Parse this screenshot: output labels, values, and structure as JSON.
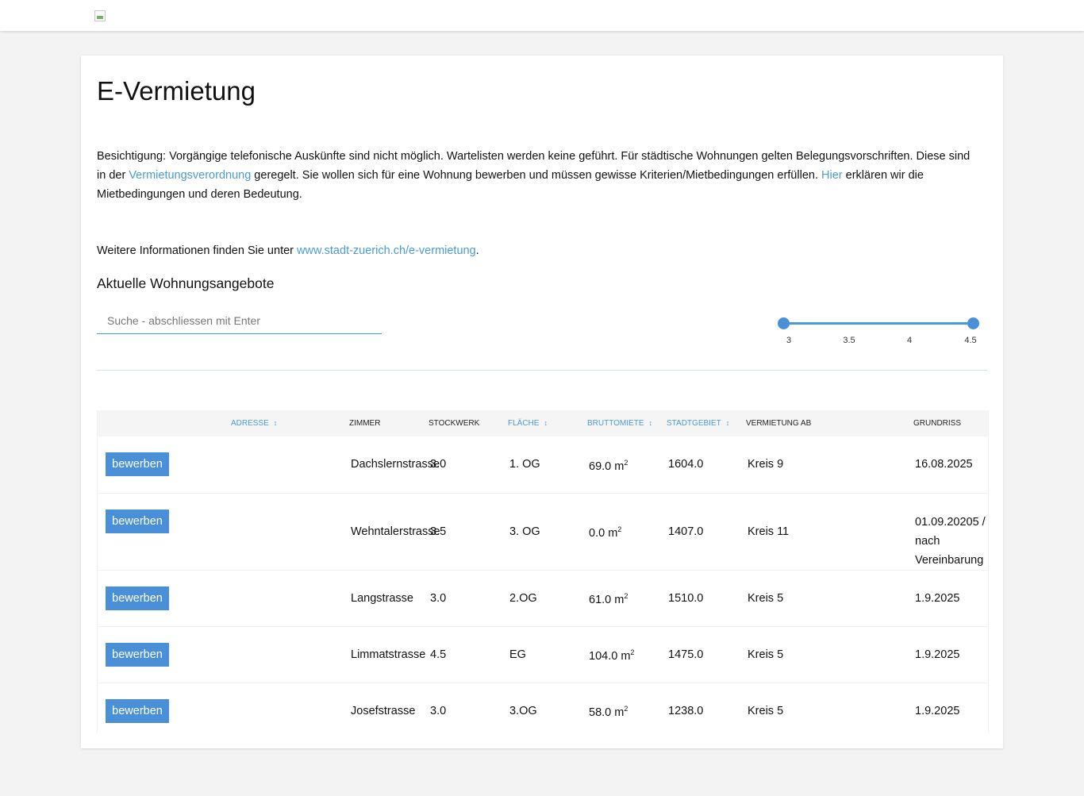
{
  "page": {
    "title": "E-Vermietung",
    "intro_part1": "Besichtigung: Vorgängige telefonische Auskünfte sind nicht möglich. Wartelisten werden keine geführt. Für städtische Wohnungen gelten Belegungsvorschriften. Diese sind in der ",
    "intro_link1": "Vermietungsverordnung",
    "intro_part2": " geregelt. Sie wollen sich für eine Wohnung bewerben und müssen gewisse Kriterien/Mietbedingungen erfüllen. ",
    "intro_link2": "Hier",
    "intro_part3": " erklären wir die Mietbedingungen und deren Bedeutung.",
    "info_prefix": "Weitere Informationen finden Sie unter ",
    "info_link": "www.stadt-zuerich.ch/e-vermietung",
    "info_suffix": ".",
    "subtitle": "Aktuelle Wohnungsangebote"
  },
  "search": {
    "placeholder": "Suche - abschliessen mit Enter",
    "value": ""
  },
  "slider": {
    "min_selected": 3,
    "max_selected": 4.5,
    "ticks": [
      "3",
      "3.5",
      "4",
      "4.5"
    ],
    "accent": "#4a90d9"
  },
  "table": {
    "headers": {
      "adresse": "Adresse",
      "zimmer": "Zimmer",
      "stockwerk": "Stockwerk",
      "flaeche": "Fläche",
      "bruttomiete": "Bruttomiete",
      "stadtgebiet": "Stadtgebiet",
      "vermietung_ab": "Vermietung ab",
      "grundriss": "Grundriss"
    },
    "area_unit": "m",
    "area_exp": "2",
    "rows": [
      {
        "button": "bewerben",
        "adresse": "Dachslernstrasse",
        "zimmer": "3.0",
        "stockwerk": "1. OG",
        "flaeche": "69.0",
        "bruttomiete": "1604.0",
        "stadtgebiet": "Kreis 9",
        "vermietung_ab": "16.08.2025",
        "grundriss": "—"
      },
      {
        "button": "bewerben",
        "adresse": "Wehntalerstrasse",
        "zimmer": "3.5",
        "stockwerk": "3. OG",
        "flaeche": "0.0",
        "bruttomiete": "1407.0",
        "stadtgebiet": "Kreis 11",
        "vermietung_ab": "01.09.20205 / nach Vereinbarung",
        "grundriss": "—"
      },
      {
        "button": "bewerben",
        "adresse": "Langstrasse",
        "zimmer": "3.0",
        "stockwerk": "2.OG",
        "flaeche": "61.0",
        "bruttomiete": "1510.0",
        "stadtgebiet": "Kreis 5",
        "vermietung_ab": "1.9.2025",
        "grundriss": "—"
      },
      {
        "button": "bewerben",
        "adresse": "Limmatstrasse",
        "zimmer": "4.5",
        "stockwerk": "EG",
        "flaeche": "104.0",
        "bruttomiete": "1475.0",
        "stadtgebiet": "Kreis 5",
        "vermietung_ab": "1.9.2025",
        "grundriss": "—"
      },
      {
        "button": "bewerben",
        "adresse": "Josefstrasse",
        "zimmer": "3.0",
        "stockwerk": "3.OG",
        "flaeche": "58.0",
        "bruttomiete": "1238.0",
        "stadtgebiet": "Kreis 5",
        "vermietung_ab": "1.9.2025",
        "grundriss": "—"
      }
    ]
  }
}
